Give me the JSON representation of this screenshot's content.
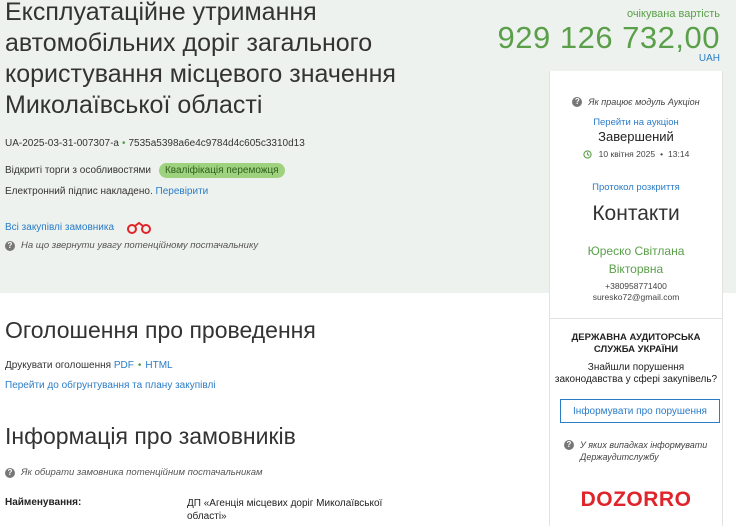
{
  "header": {
    "title": "Експлуатаційне утримання автомобільних доріг загального користування місцевого значення Миколаївської області",
    "expected_value_label": "очікувана вартість",
    "expected_value": "929 126 732,00",
    "currency": "UAH"
  },
  "tender": {
    "id": "UA-2025-03-31-007307-a",
    "hash": "7535a5398a6e4c9784d4c605c3310d13",
    "procedure": "Відкриті торги з особливостями",
    "status_badge": "Кваліфікація переможця",
    "signature_text": "Електронний підпис накладено.",
    "verify_link": "Перевірити",
    "all_purchases_link": "Всі закупівлі замовника",
    "attention_text": "На що звернути увагу потенційному постачальнику"
  },
  "announcement": {
    "title": "Оголошення про проведення",
    "print_label": "Друкувати оголошення",
    "pdf": "PDF",
    "html": "HTML",
    "plan_link": "Перейти до обгрунтування та плану закупівлі"
  },
  "customers": {
    "title": "Інформація про замовників",
    "how_choose": "Як обирати замовника потенційним постачальникам",
    "name_label": "Найменування:",
    "name_value": "ДП «Агенція місцевих доріг Миколаївської області»"
  },
  "auction_panel": {
    "how_works": "Як працює модуль Аукціон",
    "go_to_auction": "Перейти на аукціон",
    "status": "Завершений",
    "date": "10 квітня 2025",
    "time": "13:14",
    "protocol_link": "Протокол розкриття",
    "contacts_title": "Контакти",
    "contact_name_line1": "Юреско Світлана",
    "contact_name_line2": "Вікторвна",
    "phone": "+380958771400",
    "email": "suresko72@gmail.com"
  },
  "audit_panel": {
    "title": "ДЕРЖАВНА АУДИТОРСЬКА СЛУЖБА УКРАЇНИ",
    "question_line1": "Знайшли порушення",
    "question_line2": "законодавства у сфері закупівель?",
    "report_button": "Інформувати про порушення",
    "when_report": "У яких випадках інформувати Держаудитслужбу",
    "logo_text": "DOZORRO"
  },
  "colors": {
    "accent_green": "#5aa04a",
    "link_blue": "#2a7cc7",
    "badge_green": "#9fd27f",
    "logo_red": "#e0242b",
    "band_bg": "#eef2ee"
  },
  "icons": [
    "question-icon",
    "binoculars-icon",
    "clock-icon"
  ]
}
